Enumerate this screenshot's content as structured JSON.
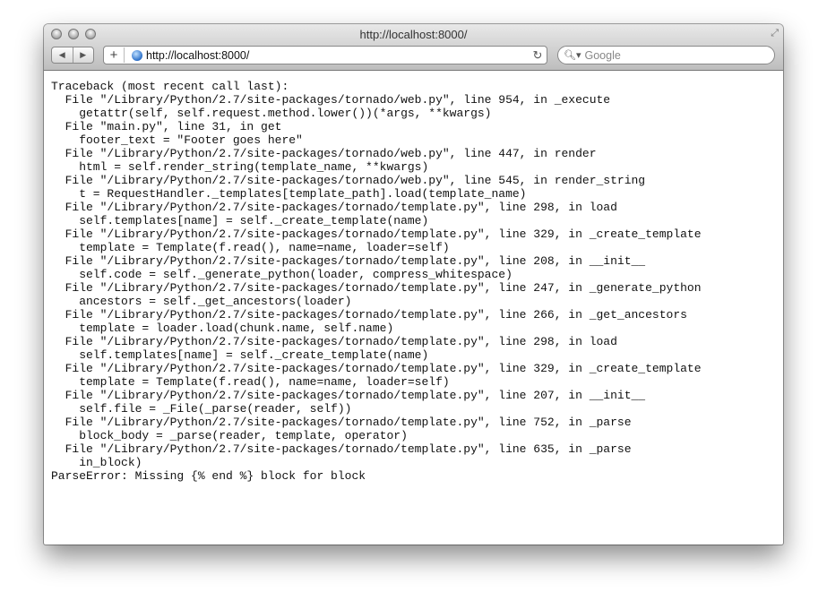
{
  "window": {
    "title": "http://localhost:8000/"
  },
  "toolbar": {
    "back_icon": "back-arrow-icon",
    "forward_icon": "forward-arrow-icon",
    "add_icon": "+",
    "url": "http://localhost:8000/",
    "reload_icon": "↻",
    "search_placeholder": "Google"
  },
  "traceback": {
    "lines": [
      "Traceback (most recent call last):",
      "  File \"/Library/Python/2.7/site-packages/tornado/web.py\", line 954, in _execute",
      "    getattr(self, self.request.method.lower())(*args, **kwargs)",
      "  File \"main.py\", line 31, in get",
      "    footer_text = \"Footer goes here\"",
      "  File \"/Library/Python/2.7/site-packages/tornado/web.py\", line 447, in render",
      "    html = self.render_string(template_name, **kwargs)",
      "  File \"/Library/Python/2.7/site-packages/tornado/web.py\", line 545, in render_string",
      "    t = RequestHandler._templates[template_path].load(template_name)",
      "  File \"/Library/Python/2.7/site-packages/tornado/template.py\", line 298, in load",
      "    self.templates[name] = self._create_template(name)",
      "  File \"/Library/Python/2.7/site-packages/tornado/template.py\", line 329, in _create_template",
      "    template = Template(f.read(), name=name, loader=self)",
      "  File \"/Library/Python/2.7/site-packages/tornado/template.py\", line 208, in __init__",
      "    self.code = self._generate_python(loader, compress_whitespace)",
      "  File \"/Library/Python/2.7/site-packages/tornado/template.py\", line 247, in _generate_python",
      "    ancestors = self._get_ancestors(loader)",
      "  File \"/Library/Python/2.7/site-packages/tornado/template.py\", line 266, in _get_ancestors",
      "    template = loader.load(chunk.name, self.name)",
      "  File \"/Library/Python/2.7/site-packages/tornado/template.py\", line 298, in load",
      "    self.templates[name] = self._create_template(name)",
      "  File \"/Library/Python/2.7/site-packages/tornado/template.py\", line 329, in _create_template",
      "    template = Template(f.read(), name=name, loader=self)",
      "  File \"/Library/Python/2.7/site-packages/tornado/template.py\", line 207, in __init__",
      "    self.file = _File(_parse(reader, self))",
      "  File \"/Library/Python/2.7/site-packages/tornado/template.py\", line 752, in _parse",
      "    block_body = _parse(reader, template, operator)",
      "  File \"/Library/Python/2.7/site-packages/tornado/template.py\", line 635, in _parse",
      "    in_block)",
      "ParseError: Missing {% end %} block for block"
    ]
  }
}
